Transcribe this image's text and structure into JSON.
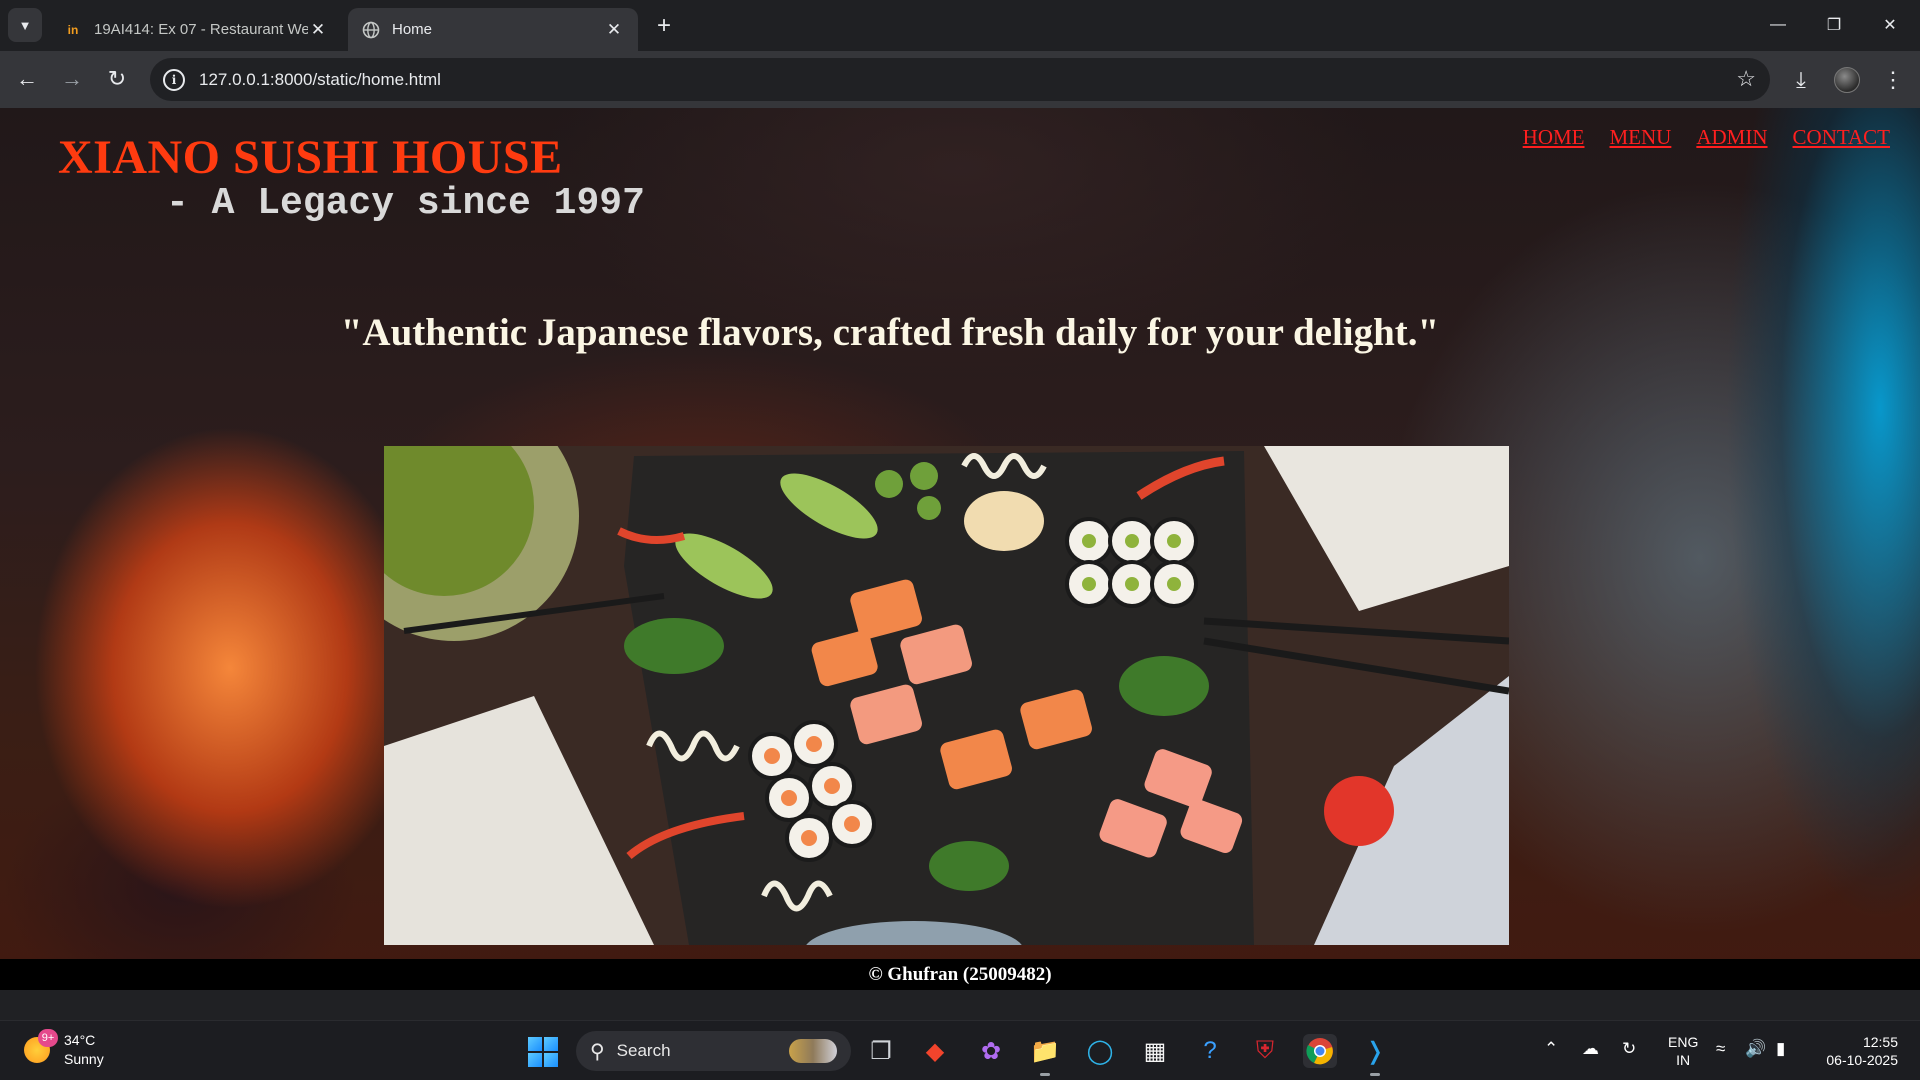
{
  "browser": {
    "tabs": [
      {
        "favicon": "in",
        "title": "19AI414: Ex 07 - Restaurant We",
        "active": false
      },
      {
        "favicon": "globe-icon",
        "title": "Home",
        "active": true
      }
    ],
    "url": "127.0.0.1:8000/static/home.html"
  },
  "page": {
    "brand": "XIANO SUSHI HOUSE",
    "tagline": "- A Legacy since 1997",
    "nav": [
      "HOME",
      "MENU",
      "ADMIN",
      "CONTACT"
    ],
    "quote": "\"Authentic Japanese flavors, crafted fresh daily for your delight.\"",
    "footer": "© Ghufran (25009482)",
    "colors": {
      "brand": "#ff3b10",
      "nav_link": "#ff1f1f",
      "quote": "#fbf6e4",
      "footer_bg": "#000000"
    }
  },
  "taskbar": {
    "weather": {
      "temp": "34°C",
      "condition": "Sunny",
      "badge": "9+"
    },
    "search_placeholder": "Search",
    "lang": {
      "line1": "ENG",
      "line2": "IN"
    },
    "clock": {
      "time": "12:55",
      "date": "06-10-2025"
    }
  }
}
